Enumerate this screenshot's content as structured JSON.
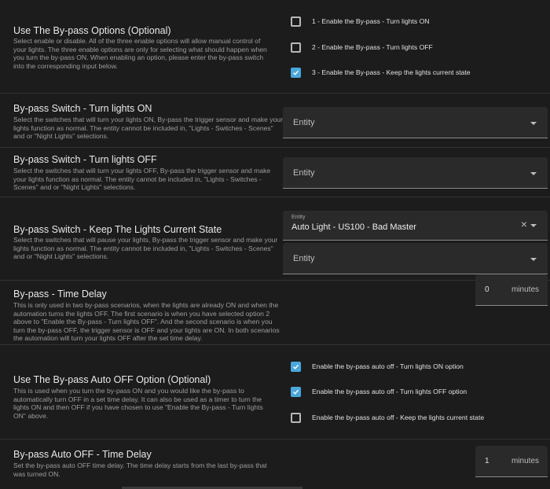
{
  "bypass_options": {
    "title": "Use The By-pass Options (Optional)",
    "description": "Select enable or disable. All of the three enable options will allow manual control of your lights. The three enable options are only for selecting what should happen when you turn the by-pass ON. When enabling an option, please enter the by-pass switch into the corresponding input below.",
    "options": [
      {
        "label": "1 - Enable the By-pass - Turn lights ON",
        "checked": false
      },
      {
        "label": "2 - Enable the By-pass - Turn lights OFF",
        "checked": false
      },
      {
        "label": "3 - Enable the By-pass - Keep the lights current state",
        "checked": true
      }
    ]
  },
  "switch_on": {
    "title": "By-pass Switch - Turn lights ON",
    "description": "Select the switches that will turn your lights ON, By-pass the trigger sensor and make your lights function as normal. The entity cannot be included in, \"Lights - Switches - Scenes\" and or \"Night Lights\" selections.",
    "placeholder": "Entity"
  },
  "switch_off": {
    "title": "By-pass Switch - Turn lights OFF",
    "description": "Select the switches that will turn your lights OFF, By-pass the trigger sensor and make your lights function as normal. The entity cannot be included in, \"Lights - Switches - Scenes\" and or \"Night Lights\" selections.",
    "placeholder": "Entity"
  },
  "switch_keep": {
    "title": "By-pass Switch - Keep The Lights Current State",
    "description": "Select the switches that will pause your lights, By-pass the trigger sensor and make your lights function as normal. The entity cannot be included in, \"Lights - Switches - Scenes\" and or \"Night Lights\" selections.",
    "selected_label": "Entity",
    "selected_value": "Auto Light - US100 - Bad Master",
    "clear_icon": "×",
    "placeholder": "Entity"
  },
  "time_delay": {
    "title": "By-pass - Time Delay",
    "description": "This is only used in two by-pass scenarios, when the lights are already ON and when the automation turns the lights OFF. The first scenario is when you have selected option 2 above to \"Enable the By-pass - Turn lights OFF\". And the second scenario is when you turn the by-pass OFF, the trigger sensor is OFF and your lights are ON. In both scenarios the automation will turn your lights OFF after the set time delay.",
    "value": "0",
    "unit": "minutes"
  },
  "auto_off_options": {
    "title": "Use The By-pass Auto OFF Option (Optional)",
    "description": "This is used when you turn the by-pass ON and you would like the by-pass to automatically turn OFF in a set time delay. It can also be used as a timer to turn the lights ON and then OFF if you have chosen to use \"Enable the By-pass - Turn lights ON\" above.",
    "options": [
      {
        "label": "Enable the by-pass auto off - Turn lights ON option",
        "checked": true
      },
      {
        "label": "Enable the by-pass auto off - Turn lights OFF option",
        "checked": true
      },
      {
        "label": "Enable the by-pass auto off - Keep the lights current state",
        "checked": false
      }
    ]
  },
  "auto_off_delay": {
    "title": "By-pass Auto OFF - Time Delay",
    "description": "Set the by-pass auto OFF time delay. The time delay starts from the last by-pass that was turned ON.",
    "value": "1",
    "unit": "minutes"
  },
  "colors": {
    "background": "#1c1c1c",
    "accent": "#4aa7dc",
    "field": "#2a2a2a"
  }
}
